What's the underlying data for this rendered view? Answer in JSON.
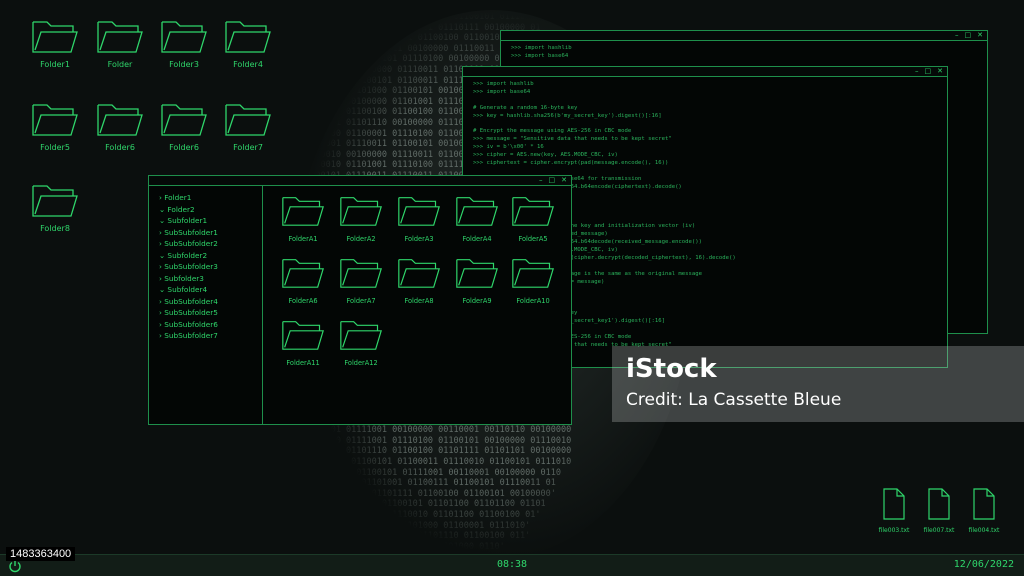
{
  "desktop": {
    "folders": [
      {
        "label": "Folder1"
      },
      {
        "label": "Folder"
      },
      {
        "label": "Folder3"
      },
      {
        "label": "Folder4"
      },
      {
        "label": "Folder5"
      },
      {
        "label": "Folder6"
      },
      {
        "label": "Folder6"
      },
      {
        "label": "Folder7"
      },
      {
        "label": "Folder8"
      }
    ],
    "text_files": [
      {
        "label": "file003.txt"
      },
      {
        "label": "file007.txt"
      },
      {
        "label": "file004.txt"
      }
    ]
  },
  "background": {
    "binary_text": "          . 01110100 01101000 01100101 01110\n        .01101110 01100101 01110111 00100000 01\n     01100011 01101111 01100100 01100101 00100000 0\n   01101001 01110011 00100000 01110011 01100101 011\n  01110010 01100101 01110100 00100000 01100001 01101\n 01100100 00100000 01110011 01100001 01100110 011001\n 01110011 01100101 01100011 01110101 01110010 0110010\n01110100 01101000 01100101 00100000 01101011 01100101\n01111001 00100000 01101001 01110011 00100000 01101000\n01101001 01100100 01100100 01100101 01101110 00100000\n01101001 01101110 00100000 01110100 01101000 01100101\n01100100 01100001 01110100 01100001 00100000 01100010\n01100001 01110011 01100101 00100000 01100110 01101111\n01110010 00100000 01110011 01100101 01100011 01110101\n01110010 01101001 01110100 01111001 00100000 01101101\n01100101 01110011 01110011 01100001 01100111 01100101\n01100101 01101110 01100011 01110010 01111001 01110000\n01110100 01100101 01100100 00100000 01110111 01101001\n01110100 01101000 00100000 01100001 01100101 01110011\n01100010 01100001 01110011 01100101 00110110 00110100\n01101000 01100001 01110011 01101000 01101100 01101001\n01100010 00100000 01101001 01101101 01110000 01101111\n01110010 01110100 00100000 01110011 01111001 01110011\n01100011 01101001 01110000 01101000 01100101 01110010\n01110100 01100101 01111000 01110100 00100000 01101001\n01110110 00100000 01100100 01100101 01100011 01101111\n01100100 01100101 00100000 01101101 01101111 01100100\n01100101 00100000 01100011 01100010 01100011 00100000\n01110000 01100001 01100100 00100000 01110101 01101110\n01110000 01100001 01100100 00100000 01100100 01100001\n01110100 01100001 00100000 01110011 01100101 01101110\n01110011 01101001 01110100 01101001 01110110 01100101\n01100100 01100101 01100011 01101111 01100100 01100101\n01100100 00100000 01101101 01100101 01110011 01110011\n01100001 01100111 01100101 00100000 01110100 01101000\n01100101 00100000 01100010 01100001 01110011 01100101\n01100110 01101111 01110010 00100000 01110100 01110010\n01100001 01101110 01110011 01101101 01101001 01110011\n01110011 01101001 01101111 01101110 00100000 01101011\n01100101 01111001 00100000 00110001 00110110 00100000\n01100010 01111001 01110100 01100101 00100000 01110010\n01100001 01101110 01100100 01101111 01101101 00100000\n 01110011 01100101 01100011 01110010 01100101 0111010\n  01101011 01100101 01111001 00110001 00100000 0110\n   01100100 01101001 01100111 01100101 01110011 01\n    '01100011 01101111 01100100 01100101 00100000'\n      '01101000 01100101 01101100 01101100 01101\n        '0110111 01110010 01101100 01100100 01'\n          '1010111 01101000 01100001 0111010'\n             '01100001 01101110 01100100 011'\n                 '0110100 01101000 0110'"
  },
  "terminal_back": {
    "code": ">>> import hashlib\n>>> import base64"
  },
  "terminal_front": {
    "code": ">>> import hashlib\n>>> import base64\n\n# Generate a random 16-byte key\n>>> key = hashlib.sha256(b'my_secret_key').digest()[:16]\n\n# Encrypt the message using AES-256 in CBC mode\n>>> message = \"Sensitive data that needs to be kept secret\"\n>>> iv = b'\\x00' * 16\n>>> cipher = AES.new(key, AES.MODE_CBC, iv)\n>>> ciphertext = cipher.encrypt(pad(message.encode(), 16))\n\n# Encode the ciphertext in base64 for transmission\n>>> encoded_ciphertext = base64.b64encode(ciphertext).decode()\n\n# Decrypt the message\n>>> print(encoded_ciphertext)\n\n# Decrypt the message using the key and initialization vector (iv)\n>>> received_message = (encoded_message)\n>>> decoded_ciphertext = base64.b64decode(received_message.encode())\n>>> cipher = AES.new(key, AES.MODE_CBC, iv)\n>>> decrypted_message = unpad(cipher.decrypt(decoded_ciphertext), 16).decode()\n\n# Check if the decrypted message is the same as the original message\n>>> print(decrypted_message == message)\n\n\n\n# Generate a random 16-byte key\n>>> key = hashlib.sha256(b'my_secret_key1').digest()[:16]\n\n# Encrypt the message using AES-256 in CBC mode\n>>> message = \"Sensitive data that needs to be kept secret\""
  },
  "explorer": {
    "tree": [
      {
        "label": "› Folder1"
      },
      {
        "label": "⌄ Folder2"
      },
      {
        "label": "   ⌄ Subfolder1"
      },
      {
        "label": "      › SubSubfolder1"
      },
      {
        "label": "      › SubSubfolder2"
      },
      {
        "label": "   ⌄ Subfolder2"
      },
      {
        "label": "      › SubSubfolder3"
      },
      {
        "label": "   › Subfolder3"
      },
      {
        "label": "   ⌄ Subfolder4"
      },
      {
        "label": "      › SubSubfolder4"
      },
      {
        "label": "      › SubSubfolder5"
      },
      {
        "label": "      › SubSubfolder6"
      },
      {
        "label": "      › SubSubfolder7"
      }
    ],
    "files": [
      {
        "label": "FolderA1"
      },
      {
        "label": "FolderA2"
      },
      {
        "label": "FolderA3"
      },
      {
        "label": "FolderA4"
      },
      {
        "label": "FolderA5"
      },
      {
        "label": "FolderA6"
      },
      {
        "label": "FolderA7"
      },
      {
        "label": "FolderA8"
      },
      {
        "label": "FolderA9"
      },
      {
        "label": "FolderA10"
      },
      {
        "label": "FolderA11"
      },
      {
        "label": "FolderA12"
      }
    ]
  },
  "window_controls": {
    "minimize": "–",
    "maximize": "□",
    "close": "✕"
  },
  "watermark": {
    "logo": "iStock",
    "credit": "Credit: La Cassette Bleue"
  },
  "stock_id": "1483363400",
  "taskbar": {
    "time": "08:38",
    "date": "12/06/2022",
    "power_icon": "power-icon"
  },
  "colors": {
    "accent": "#2fd66b",
    "background": "#0b0f0e",
    "taskbar": "#121d17"
  }
}
